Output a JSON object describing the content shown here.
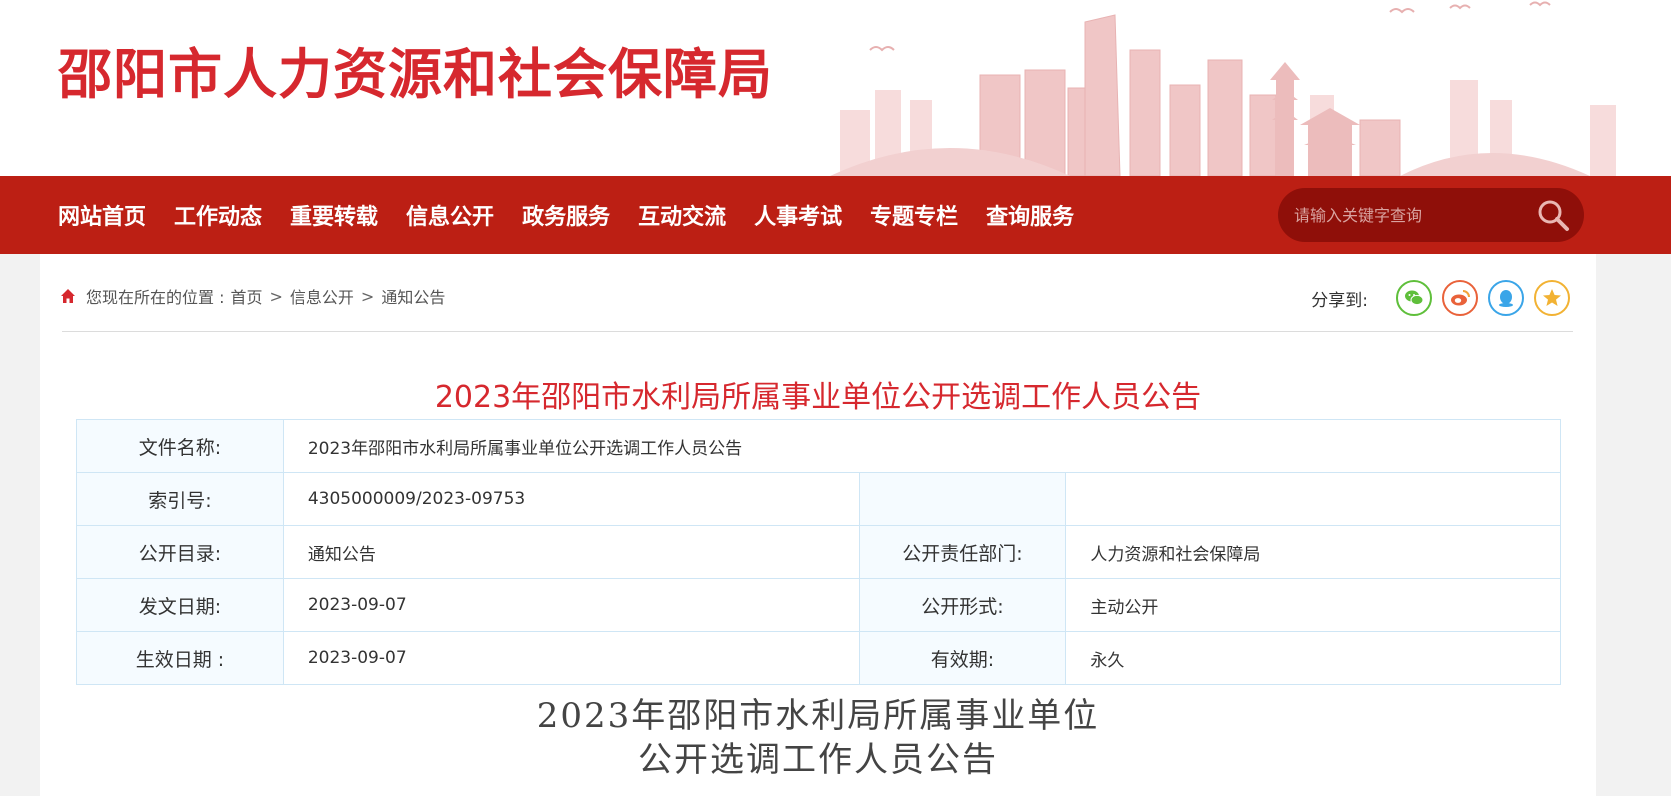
{
  "header": {
    "site_title": "邵阳市人力资源和社会保障局"
  },
  "nav": {
    "items": [
      "网站首页",
      "工作动态",
      "重要转载",
      "信息公开",
      "政务服务",
      "互动交流",
      "人事考试",
      "专题专栏",
      "查询服务"
    ],
    "search_placeholder": "请输入关键字查询"
  },
  "breadcrumb": {
    "prefix": "您现在所在的位置 :",
    "items": [
      "首页",
      "信息公开",
      "通知公告"
    ],
    "separator": ">"
  },
  "share": {
    "label": "分享到:",
    "buttons": [
      "wechat-icon",
      "weibo-icon",
      "qq-icon",
      "favorite-icon"
    ]
  },
  "article": {
    "title": "2023年邵阳市水利局所属事业单位公开选调工作人员公告",
    "meta": {
      "file_name_label": "文件名称:",
      "file_name": "2023年邵阳市水利局所属事业单位公开选调工作人员公告",
      "index_label": "索引号:",
      "index_no": "4305000009/2023-09753",
      "catalog_label": "公开目录:",
      "catalog": "通知公告",
      "dept_label": "公开责任部门:",
      "dept": "人力资源和社会保障局",
      "date_label": "发文日期:",
      "date": "2023-09-07",
      "form_label": "公开形式:",
      "form": "主动公开",
      "effective_label": "生效日期 :",
      "effective_date": "2023-09-07",
      "validity_label": "有效期:",
      "validity": "永久"
    },
    "body_title_line1": "2023年邵阳市水利局所属事业单位",
    "body_title_line2": "公开选调工作人员公告"
  },
  "colors": {
    "brand_red": "#d6282e",
    "nav_red": "#bc1f14",
    "search_bg": "#8f0f09"
  }
}
